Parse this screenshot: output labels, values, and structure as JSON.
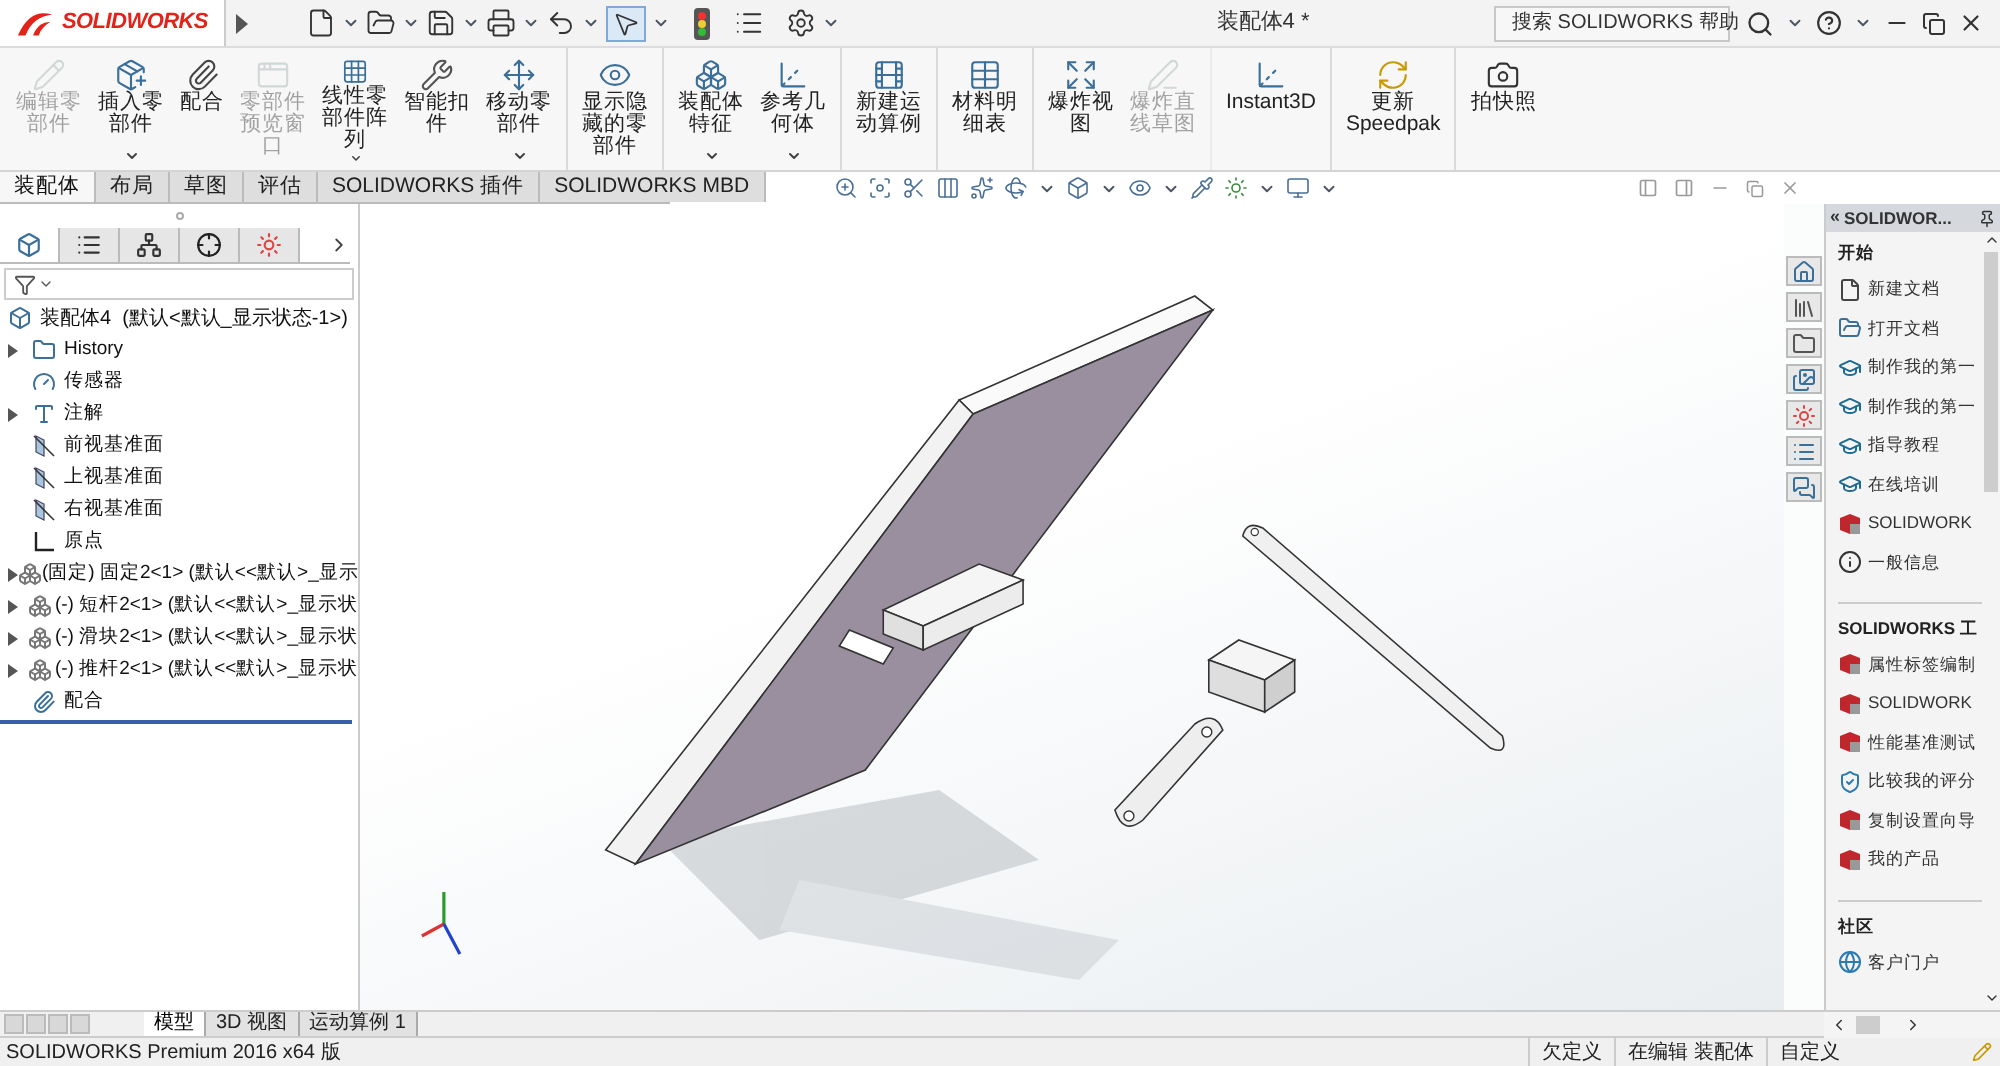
{
  "app": {
    "logo": "SOLIDWORKS",
    "title": "装配体4 *",
    "search": "搜索 SOLIDWORKS 帮助"
  },
  "ribbon": [
    {
      "lines": [
        "编辑零",
        "部件"
      ],
      "disabled": true,
      "dropdown": false,
      "separator_after": false
    },
    {
      "lines": [
        "插入零",
        "部件"
      ],
      "disabled": false,
      "dropdown": true,
      "separator_after": false
    },
    {
      "lines": [
        "配合"
      ],
      "disabled": false,
      "dropdown": false,
      "separator_after": false
    },
    {
      "lines": [
        "零部件",
        "预览窗",
        "口"
      ],
      "disabled": true,
      "dropdown": false,
      "separator_after": false
    },
    {
      "lines": [
        "线性零",
        "部件阵",
        "列"
      ],
      "disabled": false,
      "dropdown": true,
      "separator_after": false
    },
    {
      "lines": [
        "智能扣",
        "件"
      ],
      "disabled": false,
      "dropdown": false,
      "separator_after": false
    },
    {
      "lines": [
        "移动零",
        "部件"
      ],
      "disabled": false,
      "dropdown": true,
      "separator_after": true
    },
    {
      "lines": [
        "显示隐",
        "藏的零",
        "部件"
      ],
      "disabled": false,
      "dropdown": false,
      "separator_after": true
    },
    {
      "lines": [
        "装配体",
        "特征"
      ],
      "disabled": false,
      "dropdown": true,
      "separator_after": false
    },
    {
      "lines": [
        "参考几",
        "何体"
      ],
      "disabled": false,
      "dropdown": true,
      "separator_after": true
    },
    {
      "lines": [
        "新建运",
        "动算例"
      ],
      "disabled": false,
      "dropdown": false,
      "separator_after": true
    },
    {
      "lines": [
        "材料明",
        "细表"
      ],
      "disabled": false,
      "dropdown": false,
      "separator_after": true
    },
    {
      "lines": [
        "爆炸视",
        "图"
      ],
      "disabled": false,
      "dropdown": false,
      "separator_after": false
    },
    {
      "lines": [
        "爆炸直",
        "线草图"
      ],
      "disabled": true,
      "dropdown": false,
      "separator_after": true
    },
    {
      "lines": [
        "Instant3D"
      ],
      "disabled": false,
      "dropdown": false,
      "separator_after": true
    },
    {
      "lines": [
        "更新",
        "Speedpak"
      ],
      "disabled": false,
      "dropdown": false,
      "separator_after": true
    },
    {
      "lines": [
        "拍快照"
      ],
      "disabled": false,
      "dropdown": false,
      "separator_after": false
    }
  ],
  "command_tabs": [
    {
      "label": "装配体",
      "selected": true
    },
    {
      "label": "布局",
      "selected": false
    },
    {
      "label": "草图",
      "selected": false
    },
    {
      "label": "评估",
      "selected": false
    },
    {
      "label": "SOLIDWORKS 插件",
      "selected": false
    },
    {
      "label": "SOLIDWORKS MBD",
      "selected": false
    }
  ],
  "feature_tabs": [
    {
      "selected": true
    },
    {
      "selected": false
    },
    {
      "selected": false
    },
    {
      "selected": false
    },
    {
      "selected": false
    }
  ],
  "tree": {
    "root": "装配体4  (默认<默认_显示状态-1>)",
    "items": [
      {
        "kind": "folder",
        "label": "History",
        "expandable": true
      },
      {
        "kind": "sensor",
        "label": "传感器",
        "expandable": false
      },
      {
        "kind": "annotation",
        "label": "注解",
        "expandable": true
      },
      {
        "kind": "plane",
        "label": "前视基准面",
        "expandable": false
      },
      {
        "kind": "plane",
        "label": "上视基准面",
        "expandable": false
      },
      {
        "kind": "plane",
        "label": "右视基准面",
        "expandable": false
      },
      {
        "kind": "origin",
        "label": "原点",
        "expandable": false
      },
      {
        "kind": "component",
        "label": "(固定) 固定2<1> (默认<<默认>_显示",
        "expandable": true
      },
      {
        "kind": "component",
        "label": "(-) 短杆2<1> (默认<<默认>_显示状",
        "expandable": true
      },
      {
        "kind": "component",
        "label": "(-) 滑块2<1> (默认<<默认>_显示状",
        "expandable": true
      },
      {
        "kind": "component",
        "label": "(-) 推杆2<1> (默认<<默认>_显示状",
        "expandable": true
      },
      {
        "kind": "mates",
        "label": "配合",
        "expandable": false
      }
    ]
  },
  "task_pane": {
    "collapse": "«",
    "title": "SOLIDWOR...",
    "sections": [
      {
        "title": "开始",
        "items": [
          {
            "kind": "document",
            "label": "新建文档"
          },
          {
            "kind": "open",
            "label": "打开文档"
          },
          {
            "kind": "tutorial",
            "label": "制作我的第一"
          },
          {
            "kind": "tutorial",
            "label": "制作我的第一"
          },
          {
            "kind": "tutorial",
            "label": "指导教程"
          },
          {
            "kind": "tutorial",
            "label": "在线培训"
          },
          {
            "kind": "tool",
            "label": "SOLIDWORK"
          },
          {
            "kind": "info",
            "label": "一般信息"
          }
        ]
      },
      {
        "title": "SOLIDWORKS 工",
        "items": [
          {
            "kind": "tool",
            "label": "属性标签编制"
          },
          {
            "kind": "tool",
            "label": "SOLIDWORK"
          },
          {
            "kind": "tool",
            "label": "性能基准测试"
          },
          {
            "kind": "compare",
            "label": "比较我的评分"
          },
          {
            "kind": "tool",
            "label": "复制设置向导"
          },
          {
            "kind": "tool",
            "label": "我的产品"
          }
        ]
      },
      {
        "title": "社区",
        "items": [
          {
            "kind": "globe",
            "label": "客户门户"
          }
        ]
      }
    ]
  },
  "bottom_tabs": [
    {
      "label": "模型",
      "selected": true
    },
    {
      "label": "3D 视图",
      "selected": false
    },
    {
      "label": "运动算例 1",
      "selected": false
    }
  ],
  "status": {
    "product": "SOLIDWORKS Premium 2016 x64 版",
    "fields": [
      "欠定义",
      "在编辑 装配体",
      "自定义"
    ]
  }
}
